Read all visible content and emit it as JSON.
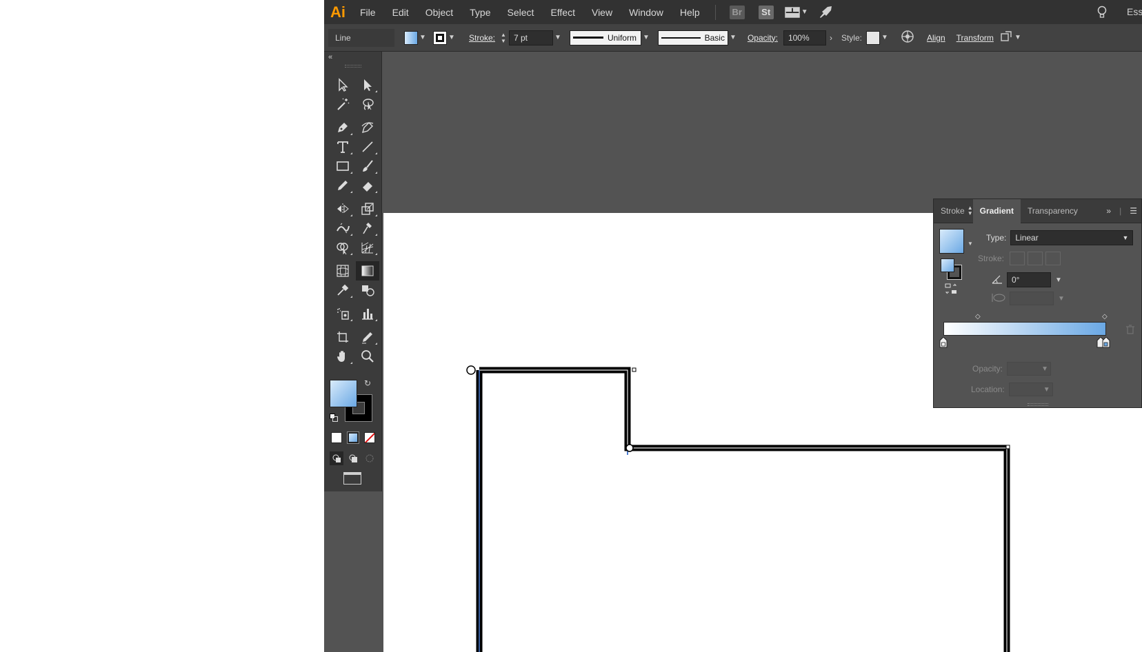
{
  "app": {
    "logo": "Ai"
  },
  "menu": {
    "items": [
      "File",
      "Edit",
      "Object",
      "Type",
      "Select",
      "Effect",
      "View",
      "Window",
      "Help"
    ],
    "bridge": "Br",
    "stock": "St",
    "workspace": "Ess"
  },
  "control": {
    "selection_label": "Line",
    "stroke_label": "Stroke:",
    "stroke_value": "7 pt",
    "profile": "Uniform",
    "brush": "Basic",
    "opacity_label": "Opacity:",
    "opacity_value": "100%",
    "style_label": "Style:",
    "align_label": "Align",
    "transform_label": "Transform"
  },
  "colors": {
    "accent": "#ff9a00",
    "fill_start": "#d9ebfb",
    "fill_end": "#6aa8e4",
    "stroke": "#000000",
    "chrome_dark": "#323232",
    "chrome": "#424242",
    "workspace": "#535353",
    "selection_blue": "#4a7bd0"
  },
  "gradient_panel": {
    "tabs": [
      "Stroke",
      "Gradient",
      "Transparency"
    ],
    "active_tab": "Gradient",
    "type_label": "Type:",
    "type_value": "Linear",
    "stroke_label": "Stroke:",
    "angle_value": "0°",
    "opacity_label": "Opacity:",
    "location_label": "Location:"
  },
  "icons": {
    "tools": [
      "selection-tool-icon",
      "direct-selection-tool-icon",
      "magic-wand-icon",
      "lasso-icon",
      "pen-tool-icon",
      "curvature-tool-icon",
      "type-tool-icon",
      "line-segment-tool-icon",
      "rectangle-tool-icon",
      "paintbrush-icon",
      "pencil-icon",
      "eraser-icon",
      "reflect-tool-icon",
      "scale-tool-icon",
      "width-tool-icon",
      "puppet-warp-icon",
      "shape-builder-icon",
      "perspective-grid-icon",
      "mesh-tool-icon",
      "gradient-tool-icon",
      "eyedropper-icon",
      "blend-tool-icon",
      "symbol-sprayer-icon",
      "column-graph-icon",
      "artboard-tool-icon",
      "slice-tool-icon",
      "hand-tool-icon",
      "zoom-tool-icon"
    ]
  }
}
